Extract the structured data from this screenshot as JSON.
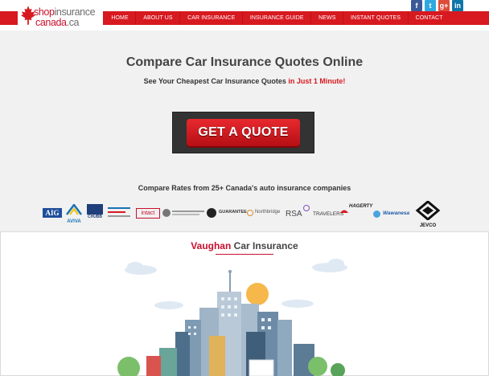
{
  "logo": {
    "line1_a": "shop",
    "line1_b": "insurance",
    "line2_a": "canada",
    "line2_b": ".ca"
  },
  "nav": {
    "items": [
      {
        "label": "HOME"
      },
      {
        "label": "ABOUT US"
      },
      {
        "label": "CAR INSURANCE"
      },
      {
        "label": "INSURANCE GUIDE"
      },
      {
        "label": "NEWS"
      },
      {
        "label": "INSTANT QUOTES"
      },
      {
        "label": "CONTACT"
      }
    ]
  },
  "social": {
    "items": [
      {
        "glyph": "f",
        "color": "#3b5998"
      },
      {
        "glyph": "t",
        "color": "#2ea8df"
      },
      {
        "glyph": "g+",
        "color": "#dd4b39"
      },
      {
        "glyph": "in",
        "color": "#0e76a8"
      }
    ]
  },
  "hero": {
    "title": "Compare Car Insurance Quotes Online",
    "subtitle_a": "See Your Cheapest Car Insurance Quotes ",
    "subtitle_b": "in Just 1 Minute!",
    "cta": "GET A QUOTE",
    "compare": "Compare Rates from 25+ Canada's auto insurance companies"
  },
  "insurers": {
    "aig": "AIG",
    "aviva": "AVIVA",
    "chubb": "CHUBB",
    "intact": "intact",
    "guarantee": "GUARANTEE",
    "northbridge": "Northbridge",
    "rsa": "RSA",
    "travelers": "TRAVELERS",
    "hagerty": "HAGERTY",
    "wawanesa": "Wawanesa",
    "jevco": "JEVCO"
  },
  "section": {
    "city": "Vaughan",
    "rest": " Car Insurance"
  },
  "colors": {
    "brand_red": "#d71920",
    "hero_bg": "#f1f1f1"
  }
}
